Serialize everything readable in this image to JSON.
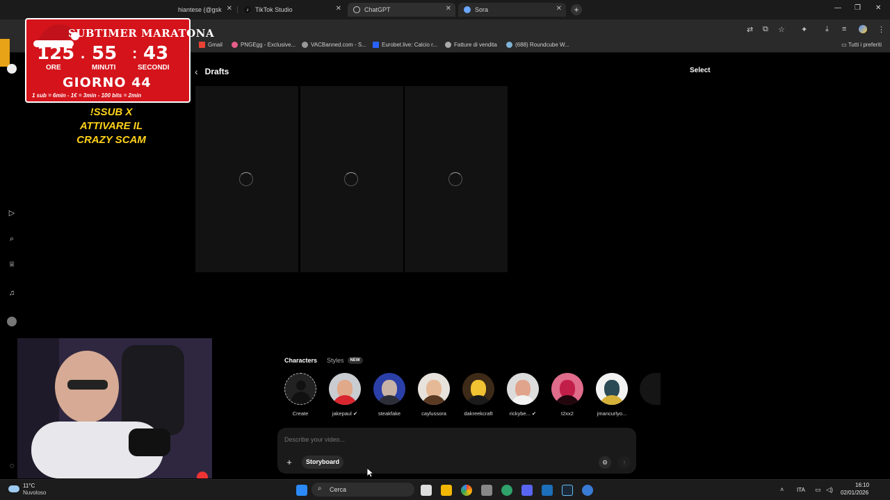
{
  "browser": {
    "tabs": [
      {
        "title": "hiantese (@gsk"
      },
      {
        "title": "TikTok Studio"
      },
      {
        "title": "ChatGPT"
      },
      {
        "title": "Sora"
      }
    ],
    "bookmarks": [
      {
        "label": "Gmail"
      },
      {
        "label": "PNGEgg - Exclusive..."
      },
      {
        "label": "VACBanned.com - S..."
      },
      {
        "label": "Eurobet.live: Calcio r..."
      },
      {
        "label": "Fatture di vendita"
      },
      {
        "label": "(688) Roundcube W..."
      }
    ],
    "bookmarks_all": "Tutti i preferiti"
  },
  "page": {
    "drafts_title": "Drafts",
    "select_label": "Select",
    "characters_tab": "Characters",
    "styles_tab": "Styles",
    "new_badge": "NEW",
    "characters": [
      {
        "name": "Create"
      },
      {
        "name": "jakepaul"
      },
      {
        "name": "steakfake"
      },
      {
        "name": "caylussora"
      },
      {
        "name": "dakreekcraft"
      },
      {
        "name": "rickybe..."
      },
      {
        "name": "t2xx2"
      },
      {
        "name": "jmancurlyo..."
      }
    ],
    "composer": {
      "placeholder": "Describe your video...",
      "storyboard_label": "Storyboard"
    }
  },
  "overlay": {
    "timer_title": "SUBTIMER MARATONA",
    "hours": "125",
    "minutes": "55",
    "seconds": "43",
    "hours_label": "ORE",
    "minutes_label": "MINUTI",
    "seconds_label": "SECONDI",
    "day": "GIORNO 44",
    "rates": "1 sub = 6min - 1€ = 3min - 100 bits = 2min",
    "promo_line1": "!SSUB X",
    "promo_line2": "ATTIVARE IL",
    "promo_line3": "CRAZY SCAM"
  },
  "taskbar": {
    "temperature": "11°C",
    "weather": "Nuvoloso",
    "search_label": "Cerca",
    "language": "ITA",
    "time": "16:10",
    "date": "02/01/2026"
  },
  "colors": {
    "timer_red": "#d4131b",
    "promo_yellow": "#ffd21a",
    "page_bg": "#000000"
  }
}
